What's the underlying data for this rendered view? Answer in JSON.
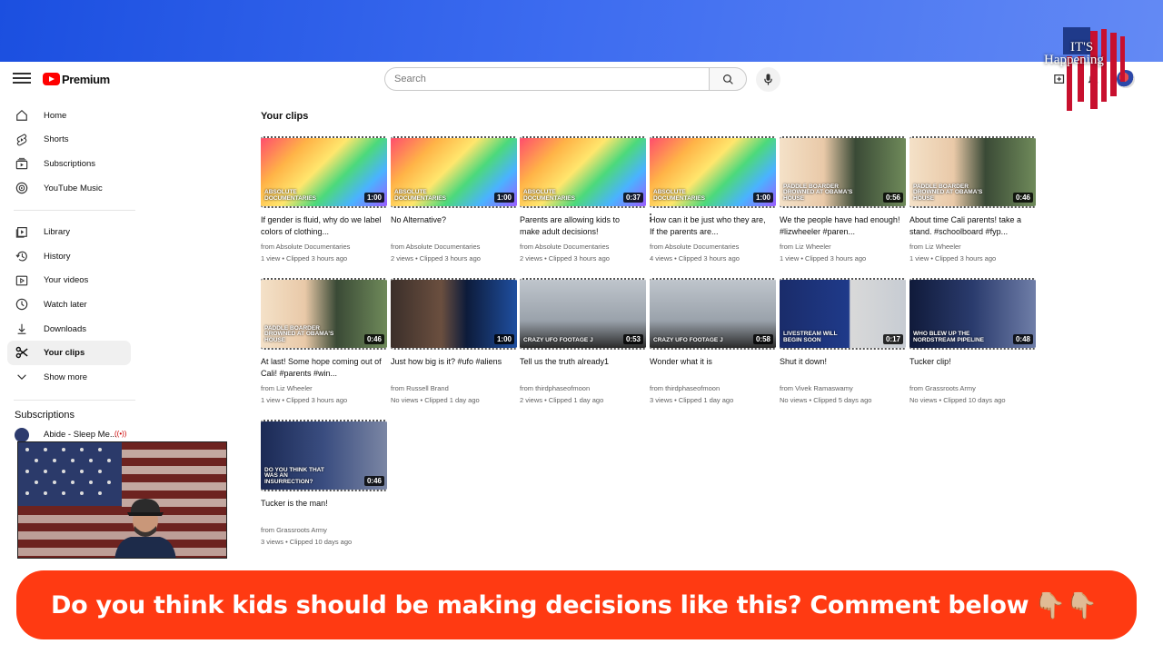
{
  "header": {
    "logo_text": "Premium",
    "search_placeholder": "Search"
  },
  "overlay": {
    "brand_line1": "IT'S",
    "brand_line2": "Happening",
    "banner_text": "Do you think kids should be making decisions like this? Comment below",
    "banner_emoji": "👇🏼👇🏼"
  },
  "sidebar": {
    "items": [
      {
        "label": "Home",
        "icon": "home-icon"
      },
      {
        "label": "Shorts",
        "icon": "shorts-icon"
      },
      {
        "label": "Subscriptions",
        "icon": "subscriptions-icon"
      },
      {
        "label": "YouTube Music",
        "icon": "music-icon"
      },
      {
        "label": "Library",
        "icon": "library-icon"
      },
      {
        "label": "History",
        "icon": "history-icon"
      },
      {
        "label": "Your videos",
        "icon": "your-videos-icon"
      },
      {
        "label": "Watch later",
        "icon": "watch-later-icon"
      },
      {
        "label": "Downloads",
        "icon": "download-icon"
      },
      {
        "label": "Your clips",
        "icon": "scissors-icon",
        "active": true
      },
      {
        "label": "Show more",
        "icon": "chevron-down-icon"
      }
    ],
    "subscriptions_heading": "Subscriptions",
    "subscriptions": [
      {
        "label": "Abide - Sleep Me...",
        "live": "((•))"
      }
    ]
  },
  "main": {
    "title": "Your clips",
    "clips": [
      {
        "title": "If gender is fluid, why do we label colors of clothing...",
        "channel": "from Absolute Documentaries",
        "stats": "1 view • Clipped 3 hours ago",
        "duration": "1:00",
        "thumb_text": "ABSOLUTE DOCUMENTARIES",
        "theme": "rainbow"
      },
      {
        "title": "No Alternative?",
        "channel": "from Absolute Documentaries",
        "stats": "2 views • Clipped 3 hours ago",
        "duration": "1:00",
        "thumb_text": "ABSOLUTE DOCUMENTARIES",
        "theme": "rainbow"
      },
      {
        "title": "Parents are allowing kids to make adult decisions!",
        "channel": "from Absolute Documentaries",
        "stats": "2 views • Clipped 3 hours ago",
        "duration": "0:37",
        "thumb_text": "ABSOLUTE DOCUMENTARIES",
        "theme": "rainbow"
      },
      {
        "title": "How can it be just who they are, If the parents are...",
        "channel": "from Absolute Documentaries",
        "stats": "4 views • Clipped 3 hours ago",
        "duration": "1:00",
        "thumb_text": "ABSOLUTE DOCUMENTARIES",
        "theme": "rainbow"
      },
      {
        "title": "We the people have had enough! #lizwheeler #paren...",
        "channel": "from Liz Wheeler",
        "stats": "1 view • Clipped 3 hours ago",
        "duration": "0:56",
        "thumb_text": "PADDLE BOARDER DROWNED AT OBAMA'S HOUSE",
        "theme": "news"
      },
      {
        "title": "About time Cali parents! take a stand. #schoolboard #fyp...",
        "channel": "from Liz Wheeler",
        "stats": "1 view • Clipped 3 hours ago",
        "duration": "0:46",
        "thumb_text": "PADDLE BOARDER DROWNED AT OBAMA'S HOUSE",
        "theme": "news"
      },
      {
        "title": "At last! Some hope coming out of Cali! #parents #win...",
        "channel": "from Liz Wheeler",
        "stats": "1 view • Clipped 3 hours ago",
        "duration": "0:46",
        "thumb_text": "PADDLE BOARDER DROWNED AT OBAMA'S HOUSE",
        "theme": "news"
      },
      {
        "title": "Just how big is it? #ufo #aliens",
        "channel": "from Russell Brand",
        "stats": "No views • Clipped 1 day ago",
        "duration": "1:00",
        "thumb_text": "",
        "theme": "brand"
      },
      {
        "title": "Tell us the truth already1",
        "channel": "from thirdphaseofmoon",
        "stats": "2 views • Clipped 1 day ago",
        "duration": "0:53",
        "thumb_text": "CRAZY UFO FOOTAGE J",
        "theme": "ufo"
      },
      {
        "title": "Wonder what it is",
        "channel": "from thirdphaseofmoon",
        "stats": "3 views • Clipped 1 day ago",
        "duration": "0:58",
        "thumb_text": "CRAZY UFO FOOTAGE J",
        "theme": "ufo"
      },
      {
        "title": "Shut it down!",
        "channel": "from Vivek Ramaswamy",
        "stats": "No views • Clipped 5 days ago",
        "duration": "0:17",
        "thumb_text": "LIVESTREAM WILL BEGIN SOON",
        "theme": "livestream"
      },
      {
        "title": "Tucker clip!",
        "channel": "from Grassroots Army",
        "stats": "No views • Clipped 10 days ago",
        "duration": "0:48",
        "thumb_text": "who blew up the Nordstream pipeline",
        "theme": "stage"
      },
      {
        "title": "Tucker is the man!",
        "channel": "from Grassroots Army",
        "stats": "3 views • Clipped 10 days ago",
        "duration": "0:46",
        "thumb_text": "Do you think that was an insurrection?",
        "theme": "stage2"
      }
    ]
  }
}
